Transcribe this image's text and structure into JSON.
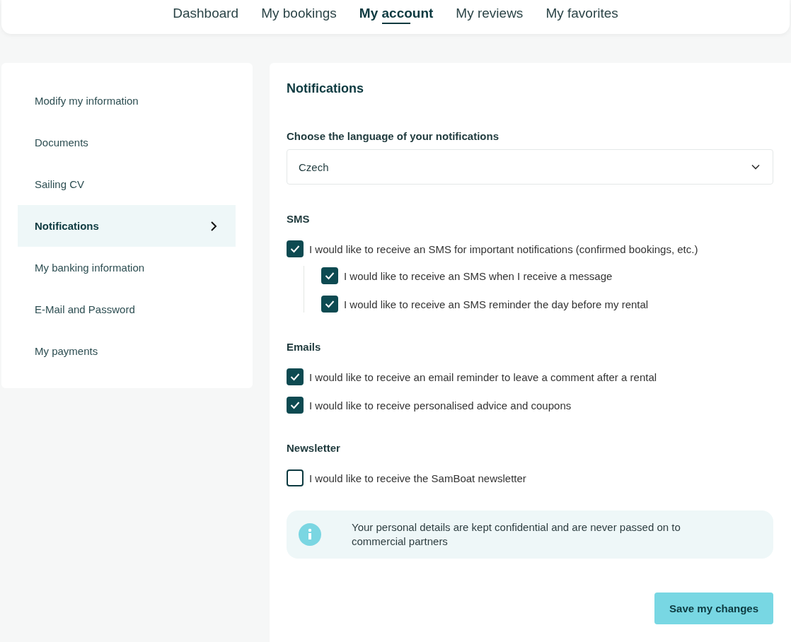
{
  "nav": {
    "tabs": [
      {
        "label": "Dashboard",
        "selected": false
      },
      {
        "label": "My bookings",
        "selected": false
      },
      {
        "label": "My account",
        "selected": true
      },
      {
        "label": "My reviews",
        "selected": false
      },
      {
        "label": "My favorites",
        "selected": false
      }
    ]
  },
  "sidebar": {
    "items": [
      {
        "label": "Modify my information",
        "selected": false
      },
      {
        "label": "Documents",
        "selected": false
      },
      {
        "label": "Sailing CV",
        "selected": false
      },
      {
        "label": "Notifications",
        "selected": true
      },
      {
        "label": "My banking information",
        "selected": false
      },
      {
        "label": "E-Mail and Password",
        "selected": false
      },
      {
        "label": "My payments",
        "selected": false
      }
    ]
  },
  "panel": {
    "title": "Notifications",
    "language": {
      "label": "Choose the language of your notifications",
      "value": "Czech"
    },
    "groups": [
      {
        "title": "SMS",
        "options": [
          {
            "label": "I would like to receive an SMS for important notifications (confirmed bookings, etc.)",
            "checked": true,
            "children": [
              {
                "label": "I would like to receive an SMS when I receive a message",
                "checked": true
              },
              {
                "label": "I would like to receive an SMS reminder the day before my rental",
                "checked": true
              }
            ]
          }
        ]
      },
      {
        "title": "Emails",
        "options": [
          {
            "label": "I would like to receive an email reminder to leave a comment after a rental",
            "checked": true
          },
          {
            "label": "I would like to receive personalised advice and coupons",
            "checked": true
          }
        ]
      },
      {
        "title": "Newsletter",
        "options": [
          {
            "label": "I would like to receive the SamBoat newsletter",
            "checked": false
          }
        ]
      }
    ],
    "info": "Your personal details are kept confidential and are never passed on to commercial partners",
    "save_button": "Save my changes"
  }
}
